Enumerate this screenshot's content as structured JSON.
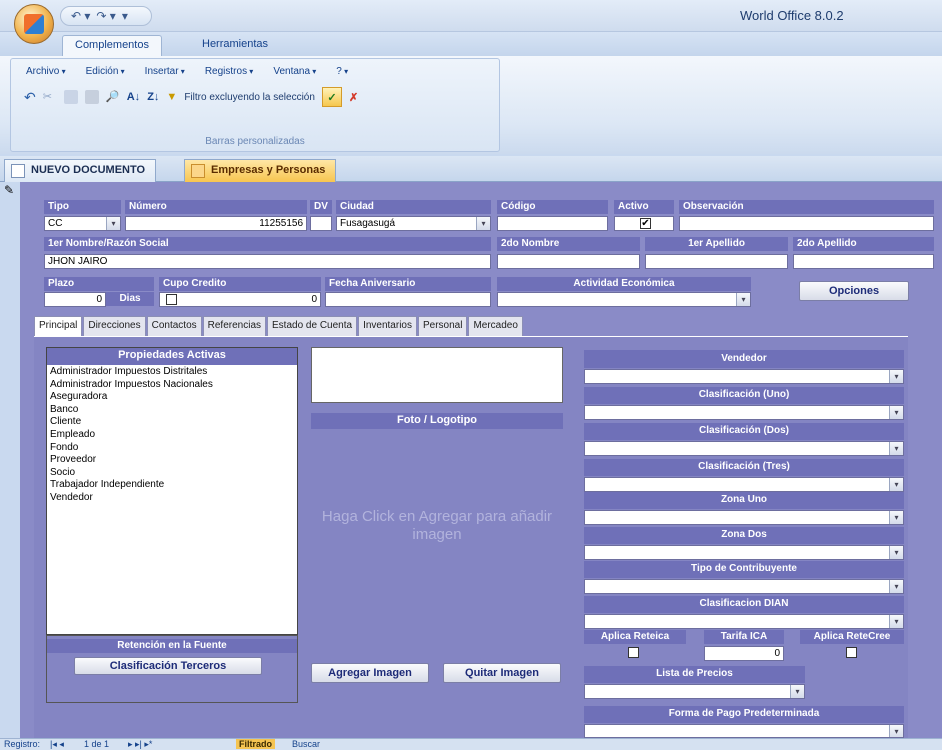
{
  "app": {
    "title": "World Office 8.0.2"
  },
  "ribbon": {
    "tabs": [
      "Complementos",
      "Herramientas"
    ],
    "menus": [
      "Archivo",
      "Edición",
      "Insertar",
      "Registros",
      "Ventana",
      "?"
    ],
    "filter_label": "Filtro excluyendo la selección",
    "group_caption": "Barras personalizadas"
  },
  "doc_tabs": [
    "NUEVO DOCUMENTO",
    "Empresas y Personas"
  ],
  "form": {
    "tipo": {
      "label": "Tipo",
      "value": "CC"
    },
    "numero": {
      "label": "Número",
      "value": "11255156"
    },
    "dv": {
      "label": "DV",
      "value": ""
    },
    "ciudad": {
      "label": "Ciudad",
      "value": "Fusagasugá"
    },
    "codigo": {
      "label": "Código",
      "value": ""
    },
    "activo": {
      "label": "Activo",
      "checked": "✔"
    },
    "observacion": {
      "label": "Observación",
      "value": ""
    },
    "nombre": {
      "label": "1er Nombre/Razón Social",
      "value": "JHON JAIRO"
    },
    "nombre2": {
      "label": "2do Nombre",
      "value": ""
    },
    "apellido1": {
      "label": "1er Apellido",
      "value": ""
    },
    "apellido2": {
      "label": "2do Apellido",
      "value": ""
    },
    "plazo": {
      "label": "Plazo",
      "value": "0",
      "unit": "Dias"
    },
    "cupo": {
      "label": "Cupo Credito",
      "value": "0"
    },
    "aniversario": {
      "label": "Fecha Aniversario",
      "value": ""
    },
    "actividad": {
      "label": "Actividad Económica",
      "value": ""
    },
    "opciones": "Opciones"
  },
  "tabs": [
    "Principal",
    "Direcciones",
    "Contactos",
    "Referencias",
    "Estado de Cuenta",
    "Inventarios",
    "Personal",
    "Mercadeo"
  ],
  "principal": {
    "props_title": "Propiedades Activas",
    "props": [
      "Administrador Impuestos Distritales",
      "Administrador Impuestos Nacionales",
      "Aseguradora",
      "Banco",
      "Cliente",
      "Empleado",
      "Fondo",
      "Proveedor",
      "Socio",
      "Trabajador Independiente",
      "Vendedor"
    ],
    "foto_title": "Foto / Logotipo",
    "foto_hint": "Haga Click en Agregar para añadir imagen",
    "retencion": "Retención en la Fuente",
    "clasif_btn": "Clasificación Terceros",
    "agregar": "Agregar Imagen",
    "quitar": "Quitar Imagen",
    "right": {
      "vendedor": "Vendedor",
      "clas1": "Clasificación (Uno)",
      "clas2": "Clasificación (Dos)",
      "clas3": "Clasificación (Tres)",
      "zona1": "Zona Uno",
      "zona2": "Zona Dos",
      "contrib": "Tipo de Contribuyente",
      "dian": "Clasificacion DIAN",
      "reteica": "Aplica Reteica",
      "tarifa": "Tarifa ICA",
      "tarifa_val": "0",
      "retecree": "Aplica ReteCree",
      "lista": "Lista de Precios",
      "pago": "Forma de Pago Predeterminada"
    }
  },
  "status": {
    "registro": "Registro:",
    "pos": "1 de 1",
    "filtrado": "Filtrado",
    "buscar": "Buscar"
  }
}
